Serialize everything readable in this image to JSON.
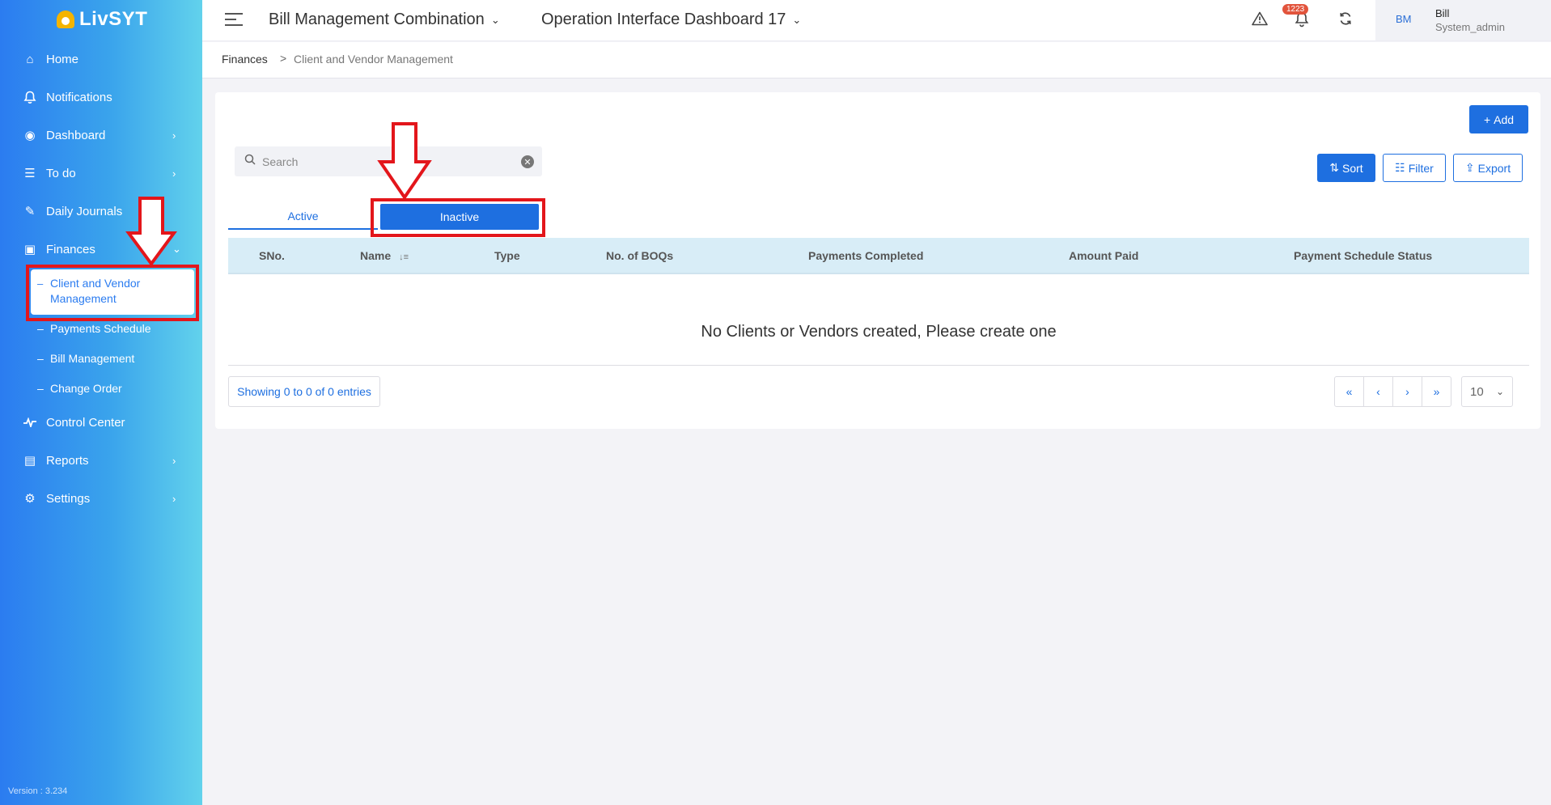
{
  "app": {
    "logo_text": "LivSYT",
    "version": "Version : 3.234"
  },
  "sidebar": {
    "items": [
      {
        "label": "Home",
        "icon": "home-icon",
        "glyph": "⌂"
      },
      {
        "label": "Notifications",
        "icon": "bell-icon",
        "glyph": "🔔"
      },
      {
        "label": "Dashboard",
        "icon": "gauge-icon",
        "glyph": "◉"
      },
      {
        "label": "To do",
        "icon": "list-icon",
        "glyph": "☰"
      },
      {
        "label": "Daily Journals",
        "icon": "pencil-icon",
        "glyph": "✎"
      },
      {
        "label": "Finances",
        "icon": "money-icon",
        "glyph": "▣"
      },
      {
        "label": "Control Center",
        "icon": "pulse-icon",
        "glyph": "〰"
      },
      {
        "label": "Reports",
        "icon": "report-icon",
        "glyph": "▤"
      },
      {
        "label": "Settings",
        "icon": "gear-icon",
        "glyph": "⚙"
      }
    ],
    "finances_sub": [
      {
        "label": "Client and Vendor Management",
        "line1": "Client and Vendor",
        "line2": "Management"
      },
      {
        "label": "Payments Schedule"
      },
      {
        "label": "Bill Management"
      },
      {
        "label": "Change Order"
      }
    ]
  },
  "header": {
    "project": "Bill Management Combination",
    "dashboard": "Operation Interface Dashboard 17",
    "notification_count": "1223",
    "user_initials": "BM",
    "user_name": "Bill",
    "user_role": "System_admin"
  },
  "breadcrumb": {
    "parent": "Finances",
    "separator": ">",
    "current": "Client and Vendor Management"
  },
  "toolbar": {
    "add_label": "Add",
    "search_placeholder": "Search",
    "sort_label": "Sort",
    "filter_label": "Filter",
    "export_label": "Export"
  },
  "tabs": {
    "active_label": "Active",
    "inactive_label": "Inactive",
    "selected": "Inactive"
  },
  "table": {
    "columns": [
      "SNo.",
      "Name",
      "Type",
      "No. of BOQs",
      "Payments Completed",
      "Amount Paid",
      "Payment Schedule Status"
    ],
    "empty_message": "No Clients or Vendors created, Please create one",
    "entries_text": "Showing 0 to 0 of 0 entries",
    "page_size": "10"
  },
  "colors": {
    "primary": "#1e6fe0",
    "annotation_red": "#e3161b",
    "table_header_bg": "#d8edf7",
    "badge": "#e2543c"
  }
}
